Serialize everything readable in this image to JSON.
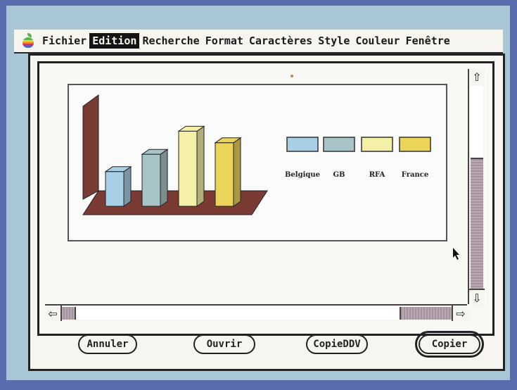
{
  "menu": {
    "items": [
      "Fichier",
      "Edition",
      "Recherche",
      "Format",
      "Caractères",
      "Style",
      "Couleur",
      "Fenêtre"
    ],
    "active_index": 1
  },
  "chart_data": {
    "type": "bar",
    "categories": [
      "Belgique",
      "GB",
      "RFA",
      "France"
    ],
    "values": [
      6,
      9,
      13,
      11
    ],
    "colors": [
      "#a8cfe6",
      "#a9c4c6",
      "#f4f0a8",
      "#ecd45a"
    ],
    "floor_color": "#7a3b34"
  },
  "buttons": {
    "cancel": "Annuler",
    "open": "Ouvrir",
    "copy_ddv": "CopieDDV",
    "copy": "Copier"
  },
  "icons": {
    "apple": "apple-logo-icon",
    "scroll_up": "arrow-up-icon",
    "scroll_down": "arrow-down-icon",
    "scroll_left": "arrow-left-icon",
    "scroll_right": "arrow-right-icon",
    "pointer": "mouse-pointer-icon"
  }
}
